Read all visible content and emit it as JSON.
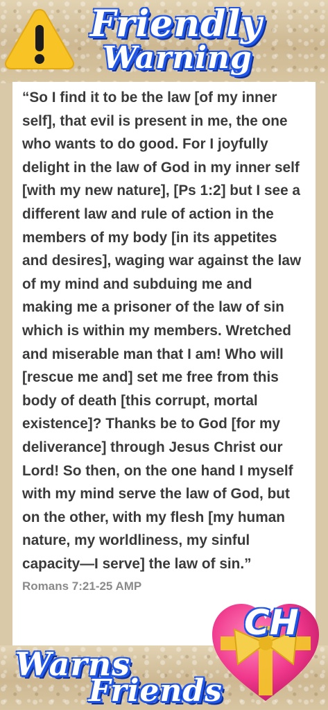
{
  "header": {
    "title_line1": "Friendly",
    "title_line2": "Warning",
    "icon": "warning-triangle-icon"
  },
  "verse": {
    "text": "“So I find it to be the law [of my inner self], that evil is present in me, the one who wants to do good. For I joyfully delight in the law of God in my inner self [with my new nature], [Ps 1:2] but I see a different law and rule of action in the members of my body [in its appetites and desires], waging war against the law of my mind and subduing me and making me a prisoner of the law of sin which is within my members. Wretched and miserable man that I am! Who will [rescue me and] set me free from this body of death [this corrupt, mortal existence]? Thanks be to God [for my deliverance] through Jesus Christ our Lord! So then, on the one hand I myself with my mind serve the law of God, but on the other, with my flesh [my human nature, my worldliness, my sinful capacity—I serve] the law of sin.”",
    "reference": "Romans 7:21-25 AMP"
  },
  "footer": {
    "line1": "Warns",
    "line2": "Friends",
    "badge": "CH",
    "icon": "heart-with-ribbon-icon"
  },
  "colors": {
    "title_outline": "#1f56e8",
    "warning_yellow": "#f7c325",
    "heart_pink": "#f0388c",
    "ribbon_gold": "#f3c52c",
    "verse_text": "#3a3a3a"
  }
}
